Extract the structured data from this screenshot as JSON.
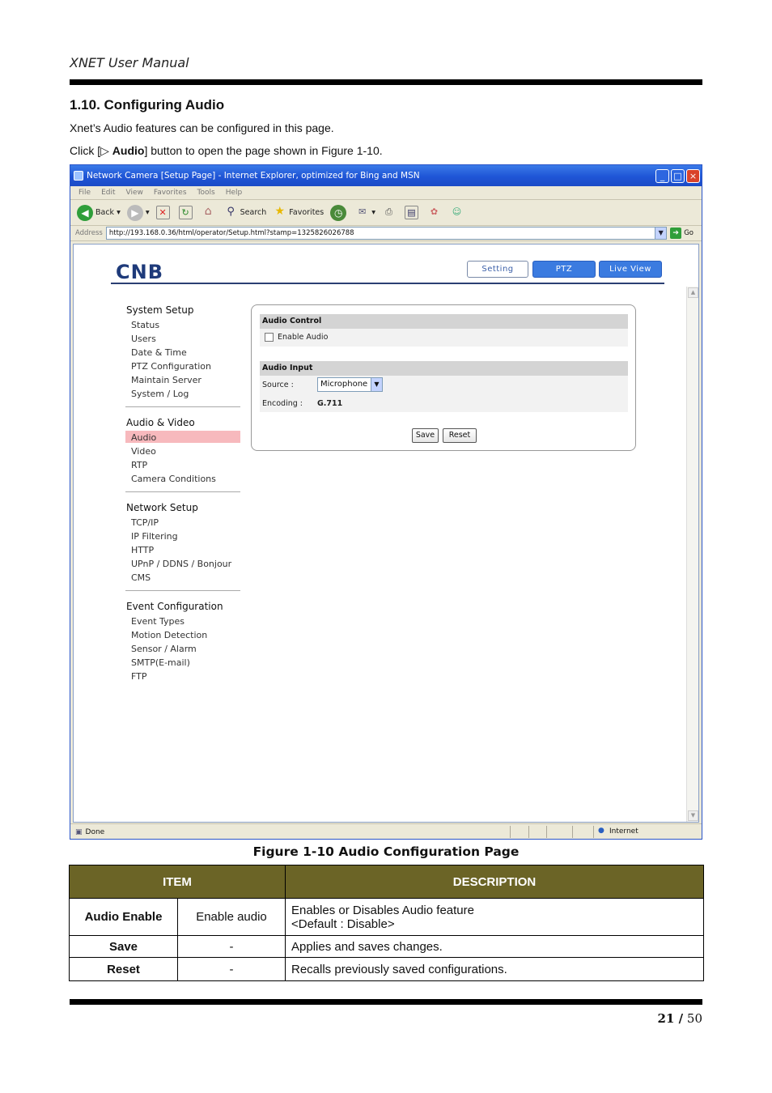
{
  "doc": {
    "header": "XNET User Manual",
    "section_title": "1.10. Configuring Audio",
    "para1": "Xnet’s Audio features can be configured in this page.",
    "para2_pre": "Click [▷ ",
    "para2_bold": "Audio",
    "para2_post": "] button to open the page shown in Figure 1-10.",
    "caption": "Figure 1-10 Audio Configuration Page",
    "page_current": "21 /",
    "page_total": "50"
  },
  "browser": {
    "title": "Network Camera [Setup Page] - Internet Explorer, optimized for Bing and MSN",
    "menu": [
      "File",
      "Edit",
      "View",
      "Favorites",
      "Tools",
      "Help"
    ],
    "toolbar": {
      "back": "Back",
      "search": "Search",
      "favorites": "Favorites"
    },
    "address_label": "Address",
    "address": "http://193.168.0.36/html/operator/Setup.html?stamp=1325826026788",
    "go": "Go",
    "status_left": "Done",
    "status_zone": "Internet"
  },
  "app": {
    "logo": "CNB",
    "nav": [
      "Setting",
      "PTZ",
      "Live View"
    ],
    "groups": [
      {
        "title": "System Setup",
        "items": [
          "Status",
          "Users",
          "Date & Time",
          "PTZ Configuration",
          "Maintain Server",
          "System / Log"
        ]
      },
      {
        "title": "Audio & Video",
        "items": [
          "Audio",
          "Video",
          "RTP",
          "Camera Conditions"
        ]
      },
      {
        "title": "Network Setup",
        "items": [
          "TCP/IP",
          "IP Filtering",
          "HTTP",
          "UPnP / DDNS / Bonjour",
          "CMS"
        ]
      },
      {
        "title": "Event Configuration",
        "items": [
          "Event Types",
          "Motion Detection",
          "Sensor / Alarm",
          "SMTP(E-mail)",
          "FTP"
        ]
      }
    ],
    "selected_item": "Audio",
    "panel": {
      "audio_control_title": "Audio Control",
      "enable_audio_label": "Enable Audio",
      "enable_audio_checked": false,
      "audio_input_title": "Audio Input",
      "source_label": "Source :",
      "source_value": "Microphone",
      "encoding_label": "Encoding :",
      "encoding_value": "G.711",
      "save": "Save",
      "reset": "Reset"
    }
  },
  "table": {
    "headers": [
      "ITEM",
      "DESCRIPTION"
    ],
    "rows": [
      {
        "item": "Audio Enable",
        "sub": "Enable audio",
        "desc1": "Enables or Disables Audio feature",
        "desc2": "<Default : Disable>"
      },
      {
        "item": "Save",
        "sub": "-",
        "desc1": "Applies and saves changes.",
        "desc2": ""
      },
      {
        "item": "Reset",
        "sub": "-",
        "desc1": "Recalls previously saved configurations.",
        "desc2": ""
      }
    ]
  },
  "colors": {
    "rule": "#000000",
    "table_header": "#6b6426",
    "nav_active": "#3b7be0",
    "selected_bg": "#f7b9bd"
  }
}
